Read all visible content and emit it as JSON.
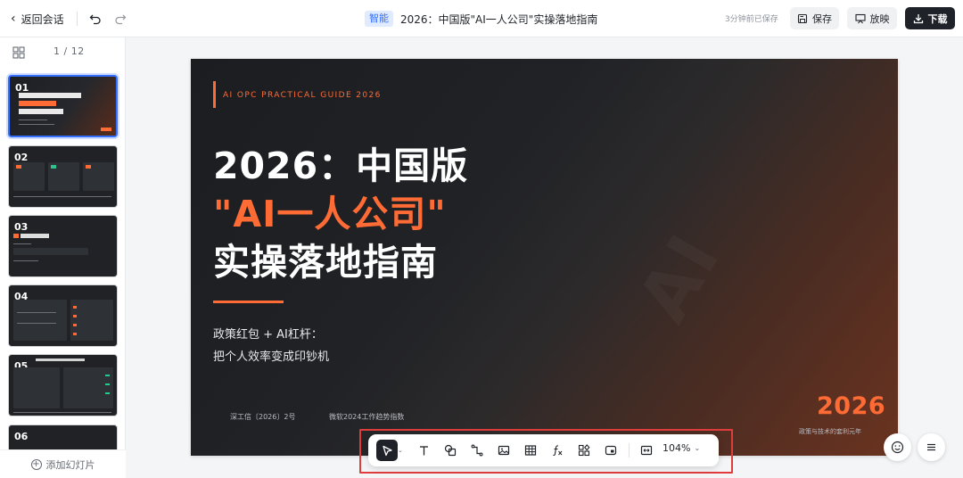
{
  "topbar": {
    "back_label": "返回会话",
    "smart_tag": "智能",
    "doc_title": "2026：中国版\"AI一人公司\"实操落地指南",
    "saved_status": "3分钟前已保存",
    "save_label": "保存",
    "present_label": "放映",
    "download_label": "下载"
  },
  "sidebar": {
    "page_counter": "1 / 12",
    "add_slide_label": "添加幻灯片",
    "thumbnails": [
      {
        "num": "01"
      },
      {
        "num": "02"
      },
      {
        "num": "03"
      },
      {
        "num": "04"
      },
      {
        "num": "05"
      },
      {
        "num": "06"
      }
    ]
  },
  "slide": {
    "eyebrow": "AI OPC PRACTICAL GUIDE 2026",
    "title_line1": "2026：中国版",
    "title_line2": "\"AI一人公司\"",
    "title_line3": "实操落地指南",
    "subtitle_line1": "政策红包 + AI杠杆：",
    "subtitle_line2": "把个人效率变成印钞机",
    "footnote_left": "深工信〔2026〕2号",
    "footnote_right": "微软2024工作趋势指数",
    "year": "2026",
    "year_caption": "政策与技术的套利元年"
  },
  "toolbar": {
    "zoom_label": "104%"
  },
  "colors": {
    "accent_orange": "#ff6b35",
    "brand_blue": "#3370ff",
    "highlight_red": "#e03c3c",
    "dark": "#1f2329"
  }
}
